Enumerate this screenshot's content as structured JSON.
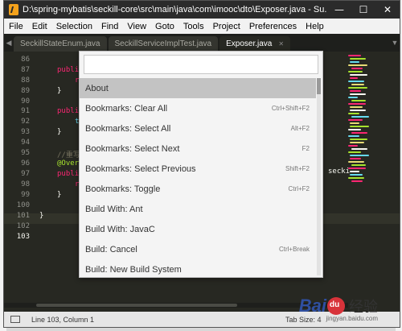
{
  "window": {
    "title": "D:\\spring-mybatis\\seckill-core\\src\\main\\java\\com\\imooc\\dto\\Exposer.java - Su...",
    "controls": {
      "minimize": "—",
      "maximize": "☐",
      "close": "✕"
    }
  },
  "menu": [
    "File",
    "Edit",
    "Selection",
    "Find",
    "View",
    "Goto",
    "Tools",
    "Project",
    "Preferences",
    "Help"
  ],
  "tabs": [
    {
      "label": "SeckillStateEnum.java",
      "active": false
    },
    {
      "label": "SeckillServiceImplTest.java",
      "active": false
    },
    {
      "label": "Exposer.java",
      "active": true
    }
  ],
  "editor": {
    "line_numbers": [
      "86",
      "87",
      "88",
      "89",
      "90",
      "91",
      "92",
      "93",
      "94",
      "95",
      "96",
      "97",
      "98",
      "99",
      "100",
      "101",
      "102",
      "103"
    ],
    "fragments": {
      "l87": "publi",
      "l88": "r",
      "l89": "}",
      "l91": "publi",
      "l92": "t",
      "l93": "}",
      "l95": "//重写",
      "l96": "@Over",
      "l97": "publi",
      "l98": "r",
      "l100": "}",
      "l102": "}"
    },
    "right_fragment": "secki"
  },
  "palette": {
    "input_value": "",
    "items": [
      {
        "label": "About",
        "shortcut": "",
        "selected": true
      },
      {
        "label": "Bookmarks: Clear All",
        "shortcut": "Ctrl+Shift+F2",
        "selected": false
      },
      {
        "label": "Bookmarks: Select All",
        "shortcut": "Alt+F2",
        "selected": false
      },
      {
        "label": "Bookmarks: Select Next",
        "shortcut": "F2",
        "selected": false
      },
      {
        "label": "Bookmarks: Select Previous",
        "shortcut": "Shift+F2",
        "selected": false
      },
      {
        "label": "Bookmarks: Toggle",
        "shortcut": "Ctrl+F2",
        "selected": false
      },
      {
        "label": "Build With: Ant",
        "shortcut": "",
        "selected": false
      },
      {
        "label": "Build With: JavaC",
        "shortcut": "",
        "selected": false
      },
      {
        "label": "Build: Cancel",
        "shortcut": "Ctrl+Break",
        "selected": false
      },
      {
        "label": "Build: New Build System",
        "shortcut": "",
        "selected": false
      }
    ]
  },
  "status": {
    "position": "Line 103, Column 1",
    "tab_size": "Tab Size: 4"
  },
  "watermark": {
    "brand": "Bai",
    "paw_text": "du",
    "zh": "经验",
    "url": "jingyan.baidu.com"
  },
  "colors": {
    "editor_bg": "#272822",
    "keyword": "#f92672",
    "comment": "#75715e",
    "annotation": "#a6e22e",
    "palette_selected": "#c3c3c3"
  }
}
